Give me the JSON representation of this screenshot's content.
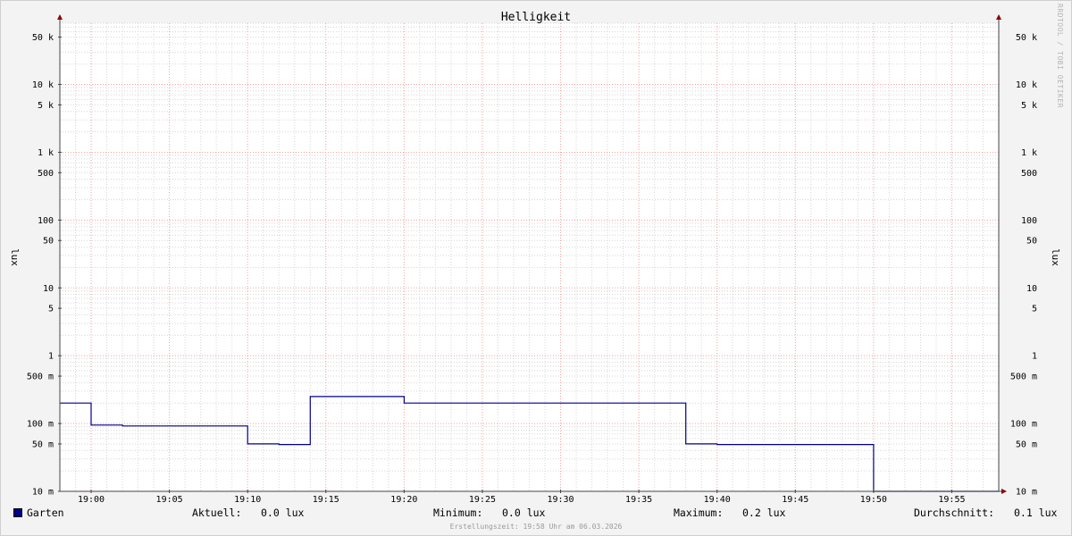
{
  "chart_data": {
    "type": "line",
    "title": "Helligkeit",
    "ylabel": "lux",
    "yscale": "log",
    "ylim": [
      0.01,
      80000
    ],
    "x_tick_labels": [
      "19:00",
      "19:05",
      "19:10",
      "19:15",
      "19:20",
      "19:25",
      "19:30",
      "19:35",
      "19:40",
      "19:45",
      "19:50",
      "19:55"
    ],
    "x_ticks_min": [
      960,
      965,
      970,
      975,
      980,
      985,
      990,
      995,
      1000,
      1005,
      1010,
      1015
    ],
    "xlim_min": [
      958.0,
      1018.0
    ],
    "y_ticks": [
      {
        "value": 0.01,
        "label": "10 m"
      },
      {
        "value": 0.05,
        "label": "50 m"
      },
      {
        "value": 0.1,
        "label": "100 m"
      },
      {
        "value": 0.5,
        "label": "500 m"
      },
      {
        "value": 1,
        "label": "1"
      },
      {
        "value": 5,
        "label": "5"
      },
      {
        "value": 10,
        "label": "10"
      },
      {
        "value": 50,
        "label": "50"
      },
      {
        "value": 100,
        "label": "100"
      },
      {
        "value": 500,
        "label": "500"
      },
      {
        "value": 1000,
        "label": "1 k"
      },
      {
        "value": 5000,
        "label": "5 k"
      },
      {
        "value": 10000,
        "label": "10 k"
      },
      {
        "value": 50000,
        "label": "50 k"
      }
    ],
    "series": [
      {
        "name": "Garten",
        "color": "#00008b",
        "step": true,
        "points": [
          {
            "x": 958.0,
            "y": 0.2
          },
          {
            "x": 960.0,
            "y": 0.095
          },
          {
            "x": 962.0,
            "y": 0.092
          },
          {
            "x": 970.0,
            "y": 0.05
          },
          {
            "x": 972.0,
            "y": 0.049
          },
          {
            "x": 974.0,
            "y": 0.25
          },
          {
            "x": 980.0,
            "y": 0.2
          },
          {
            "x": 998.0,
            "y": 0.05
          },
          {
            "x": 1000.0,
            "y": 0.049
          },
          {
            "x": 1010.0,
            "y": 0.01
          },
          {
            "x": 1018.0,
            "y": 0.01
          }
        ]
      }
    ],
    "grid": true,
    "legend_placement": "bottom"
  },
  "legend": {
    "series_name": "Garten",
    "current_label": "Aktuell:",
    "current_value": "0.0 lux",
    "min_label": "Minimum:",
    "min_value": "0.0 lux",
    "max_label": "Maximum:",
    "max_value": "0.2 lux",
    "avg_label": "Durchschnitt:",
    "avg_value": "0.1 lux"
  },
  "footer": "Erstellungszeit: 19:58 Uhr am 06.03.2026",
  "watermark": "RRDTOOL / TOBI OETIKER"
}
